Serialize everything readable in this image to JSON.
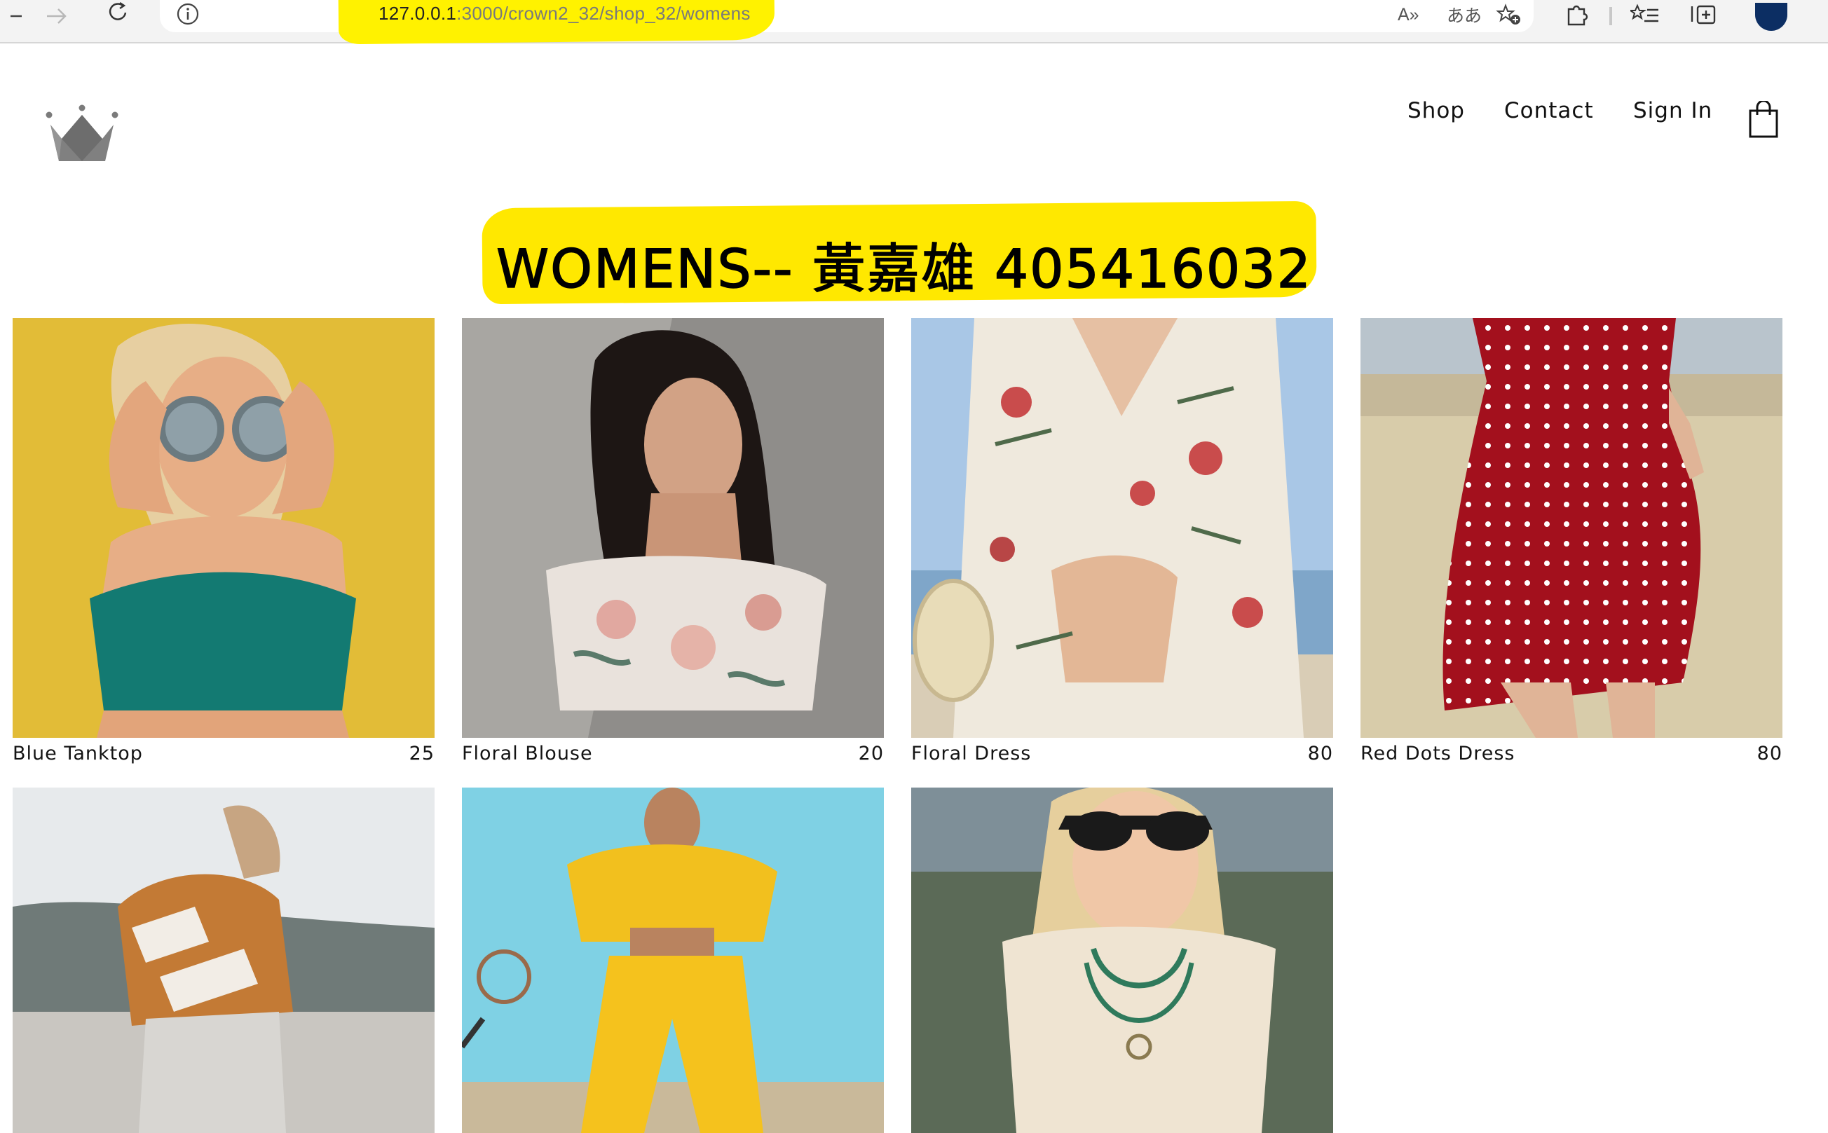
{
  "browser": {
    "url_host": "127.0.0.1",
    "url_path": ":3000/crown2_32/shop_32/womens",
    "read_aloud_label": "A»",
    "translate_label": "ああ"
  },
  "header": {
    "logo_icon": "crown-logo-icon",
    "nav": {
      "shop": "Shop",
      "contact": "Contact",
      "sign_in": "Sign In"
    },
    "cart_icon": "shopping-bag-icon"
  },
  "page": {
    "title": "WOMENS-- 黃嘉雄 405416032"
  },
  "products": [
    {
      "name": "Blue Tanktop",
      "price": "25"
    },
    {
      "name": "Floral Blouse",
      "price": "20"
    },
    {
      "name": "Floral Dress",
      "price": "80"
    },
    {
      "name": "Red Dots Dress",
      "price": "80"
    },
    {
      "name": "",
      "price": ""
    },
    {
      "name": "",
      "price": ""
    },
    {
      "name": "",
      "price": ""
    }
  ],
  "colors": {
    "highlight": "#fff200",
    "text": "#111111",
    "logo": "#7b7b7b"
  }
}
